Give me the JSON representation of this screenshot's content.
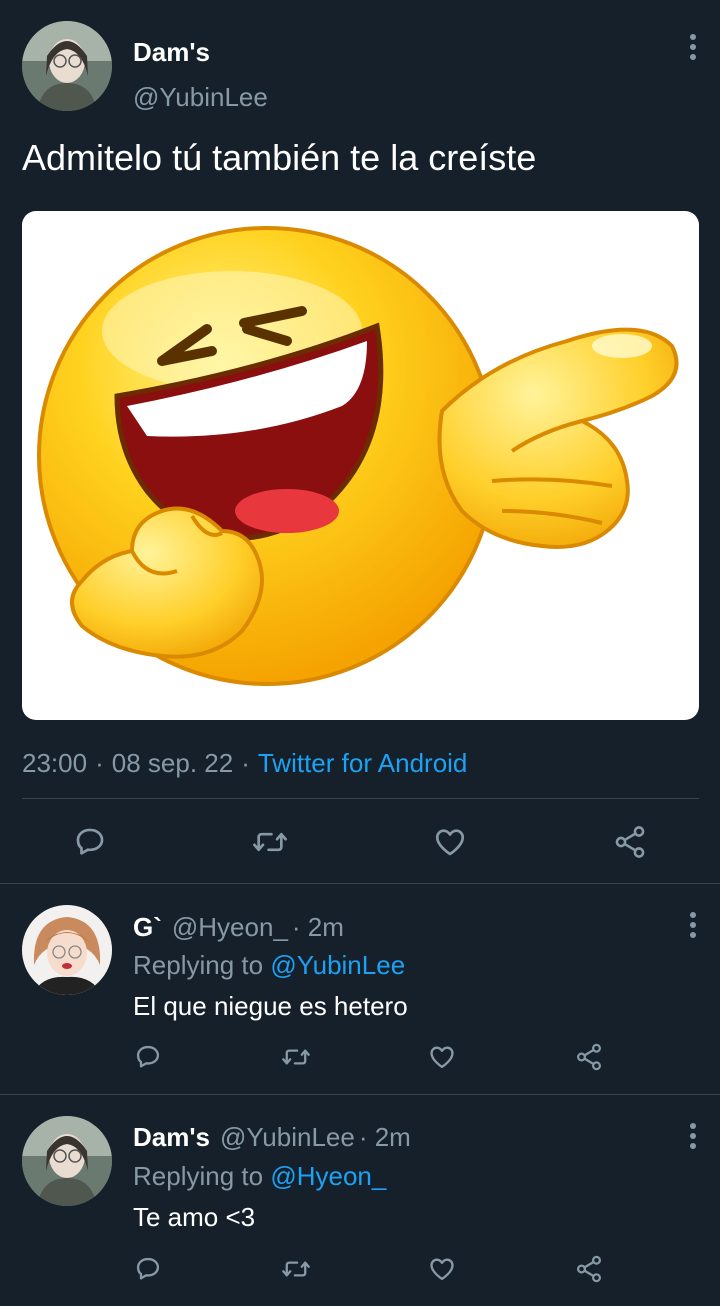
{
  "tweet": {
    "author_name": "Dam's",
    "author_handle": "@YubinLee",
    "text": "Admitelo tú también te la creíste",
    "time": "23:00",
    "sep1": "·",
    "date": "08 sep. 22",
    "sep2": "·",
    "source": "Twitter for Android",
    "image_alt": "laughing-pointing-emoji"
  },
  "replies": [
    {
      "name": "G`",
      "handle": "@Hyeon_",
      "time": "· 2m",
      "replying_prefix": "Replying to",
      "replying_to": "@YubinLee",
      "text": "El que niegue es hetero"
    },
    {
      "name": "Dam's",
      "handle": "@YubinLee",
      "time": "· 2m",
      "replying_prefix": "Replying to",
      "replying_to": "@Hyeon_",
      "text": "Te amo <3"
    }
  ],
  "colors": {
    "background": "#15202b",
    "accent": "#1da1f2",
    "muted": "#8899a6",
    "divider": "#38444d"
  },
  "icons": [
    "reply-icon",
    "retweet-icon",
    "like-icon",
    "share-icon",
    "more-icon"
  ]
}
